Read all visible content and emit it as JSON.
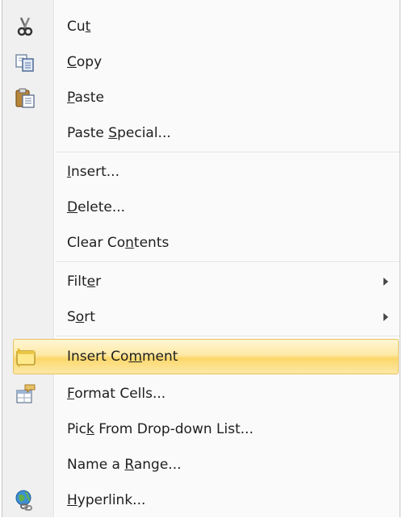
{
  "menu": {
    "items": [
      {
        "id": "cut",
        "pre": "Cu",
        "accel": "t",
        "post": "",
        "icon": "scissors-icon"
      },
      {
        "id": "copy",
        "pre": "",
        "accel": "C",
        "post": "opy",
        "icon": "copy-icon"
      },
      {
        "id": "paste",
        "pre": "",
        "accel": "P",
        "post": "aste",
        "icon": "paste-icon"
      },
      {
        "id": "paste-special",
        "pre": "Paste ",
        "accel": "S",
        "post": "pecial..."
      },
      {
        "id": "insert",
        "pre": "",
        "accel": "I",
        "post": "nsert..."
      },
      {
        "id": "delete",
        "pre": "",
        "accel": "D",
        "post": "elete..."
      },
      {
        "id": "clear-contents",
        "pre": "Clear Co",
        "accel": "n",
        "post": "tents"
      },
      {
        "id": "filter",
        "pre": "Filt",
        "accel": "e",
        "post": "r",
        "submenu": true
      },
      {
        "id": "sort",
        "pre": "S",
        "accel": "o",
        "post": "rt",
        "submenu": true
      },
      {
        "id": "insert-comment",
        "pre": "Insert Co",
        "accel": "m",
        "post": "ment",
        "icon": "comment-icon",
        "highlighted": true
      },
      {
        "id": "format-cells",
        "pre": "",
        "accel": "F",
        "post": "ormat Cells...",
        "icon": "format-cells-icon"
      },
      {
        "id": "pick-from-list",
        "pre": "Pic",
        "accel": "k",
        "post": " From Drop-down List..."
      },
      {
        "id": "name-range",
        "pre": "Name a ",
        "accel": "R",
        "post": "ange..."
      },
      {
        "id": "hyperlink",
        "pre": "",
        "accel": "H",
        "post": "yperlink...",
        "icon": "hyperlink-icon"
      }
    ]
  },
  "colors": {
    "highlight_top": "#fff6d4",
    "highlight_bottom": "#fbd76b",
    "highlight_border": "#e7c35f",
    "gutter": "#f0f0f0"
  }
}
